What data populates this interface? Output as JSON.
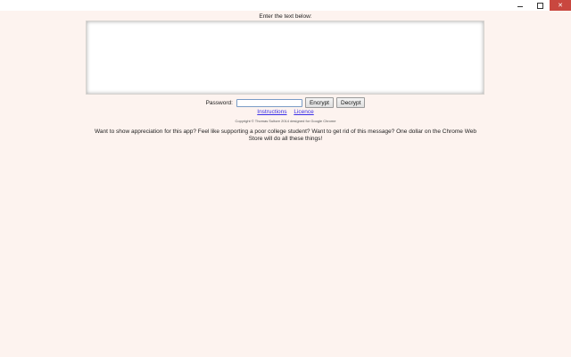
{
  "window": {
    "minimize_icon": "minimize-icon",
    "maximize_icon": "maximize-icon",
    "close_icon": "close-icon",
    "close_glyph": "✕",
    "close_color": "#c9473f"
  },
  "main": {
    "prompt": "Enter the text below:",
    "text_value": ""
  },
  "controls": {
    "password_label": "Password:",
    "password_value": "",
    "encrypt_label": "Encrypt",
    "decrypt_label": "Decrypt"
  },
  "links": {
    "instructions": "Instructions",
    "licence": "Licence",
    "link_color": "#3a2ee8"
  },
  "footer": {
    "copyright": "Copyright © Thomas Sultore 2014 designed for Google Chrome",
    "appeal": "Want to show appreciation for this app? Feel like supporting a poor college student? Want to get rid of this message? One dollar on the Chrome Web Store will do all these things!"
  },
  "colors": {
    "background": "#fdf3ef"
  }
}
